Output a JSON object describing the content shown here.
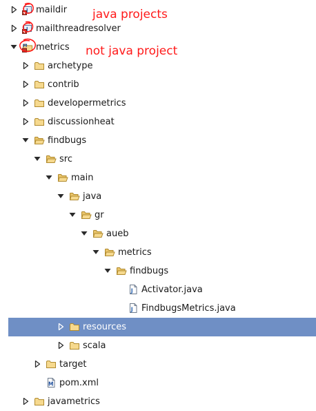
{
  "colors": {
    "folder_fill": "#f6d98e",
    "folder_stroke": "#b08a2e",
    "selection": "#6f8fc5",
    "annotation": "#ff1a1a"
  },
  "tree": [
    {
      "label": "maildir",
      "depth": 0,
      "twisty": "collapsed",
      "icon": "java-project-icon"
    },
    {
      "label": "mailthreadresolver",
      "depth": 0,
      "twisty": "collapsed",
      "icon": "java-project-icon"
    },
    {
      "label": "metrics",
      "depth": 0,
      "twisty": "expanded",
      "icon": "maven-project-icon"
    },
    {
      "label": "archetype",
      "depth": 1,
      "twisty": "collapsed",
      "icon": "folder-icon"
    },
    {
      "label": "contrib",
      "depth": 1,
      "twisty": "collapsed",
      "icon": "folder-icon"
    },
    {
      "label": "developermetrics",
      "depth": 1,
      "twisty": "collapsed",
      "icon": "folder-icon"
    },
    {
      "label": "discussionheat",
      "depth": 1,
      "twisty": "collapsed",
      "icon": "folder-icon"
    },
    {
      "label": "findbugs",
      "depth": 1,
      "twisty": "expanded",
      "icon": "folder-open-icon"
    },
    {
      "label": "src",
      "depth": 2,
      "twisty": "expanded",
      "icon": "folder-open-icon"
    },
    {
      "label": "main",
      "depth": 3,
      "twisty": "expanded",
      "icon": "folder-open-icon"
    },
    {
      "label": "java",
      "depth": 4,
      "twisty": "expanded",
      "icon": "folder-open-icon"
    },
    {
      "label": "gr",
      "depth": 5,
      "twisty": "expanded",
      "icon": "folder-open-icon"
    },
    {
      "label": "aueb",
      "depth": 6,
      "twisty": "expanded",
      "icon": "folder-open-icon"
    },
    {
      "label": "metrics",
      "depth": 7,
      "twisty": "expanded",
      "icon": "folder-open-icon"
    },
    {
      "label": "findbugs",
      "depth": 8,
      "twisty": "expanded",
      "icon": "folder-open-icon"
    },
    {
      "label": "Activator.java",
      "depth": 9,
      "twisty": "none",
      "icon": "java-file-icon"
    },
    {
      "label": "FindbugsMetrics.java",
      "depth": 9,
      "twisty": "none",
      "icon": "java-file-icon"
    },
    {
      "label": "resources",
      "depth": 4,
      "twisty": "collapsed",
      "icon": "folder-icon",
      "selected": true
    },
    {
      "label": "scala",
      "depth": 4,
      "twisty": "collapsed",
      "icon": "folder-icon"
    },
    {
      "label": "target",
      "depth": 2,
      "twisty": "collapsed",
      "icon": "folder-icon"
    },
    {
      "label": "pom.xml",
      "depth": 2,
      "twisty": "none",
      "icon": "maven-pom-icon"
    },
    {
      "label": "javametrics",
      "depth": 1,
      "twisty": "collapsed",
      "icon": "folder-icon"
    }
  ],
  "annotations": {
    "java_projects": "java projects",
    "not_java_project": "not java project"
  }
}
